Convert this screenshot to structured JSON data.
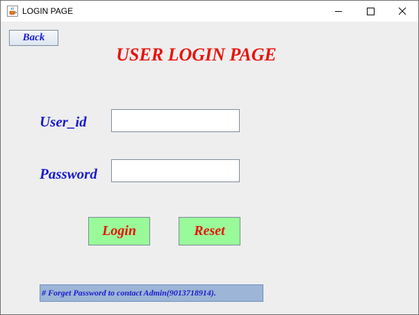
{
  "window": {
    "title": "LOGIN PAGE",
    "controls": {
      "minimize": "minimize-icon",
      "maximize": "maximize-icon",
      "close": "close-icon"
    }
  },
  "app_icon": "java-cup-icon",
  "back_button": {
    "label": "Back"
  },
  "heading": "USER LOGIN PAGE",
  "form": {
    "user_id_label": "User_id",
    "user_id_value": "",
    "password_label": "Password",
    "password_value": ""
  },
  "buttons": {
    "login": "Login",
    "reset": "Reset"
  },
  "note": "# Forget Password to contact Admin(9013718914).",
  "colors": {
    "heading": "#e8130b",
    "labels": "#1a1acc",
    "button_background": "#99fa99",
    "button_text": "#e8130b",
    "note_background": "#9db5d6",
    "window_background": "#eeeeee"
  }
}
